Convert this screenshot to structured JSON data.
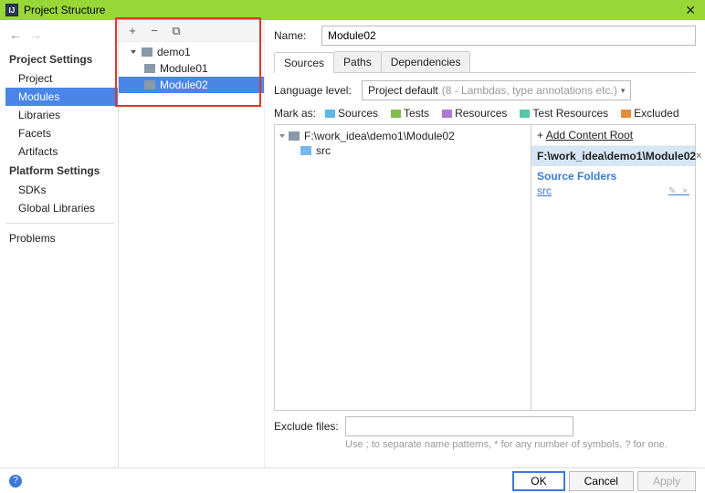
{
  "titlebar": {
    "title": "Project Structure"
  },
  "nav": {
    "back": "←",
    "forward": "→",
    "section1": "Project Settings",
    "items1": [
      "Project",
      "Modules",
      "Libraries",
      "Facets",
      "Artifacts"
    ],
    "section2": "Platform Settings",
    "items2": [
      "SDKs",
      "Global Libraries"
    ],
    "problems": "Problems"
  },
  "tree": {
    "root": "demo1",
    "children": [
      "Module01",
      "Module02"
    ]
  },
  "form": {
    "name_label": "Name:",
    "name_value": "Module02",
    "tabs": [
      "Sources",
      "Paths",
      "Dependencies"
    ],
    "lang_label": "Language level:",
    "lang_value": "Project default",
    "lang_hint": "(8 - Lambdas, type annotations etc.)",
    "markas_label": "Mark as:",
    "mark_items": [
      {
        "label": "Sources"
      },
      {
        "label": "Tests"
      },
      {
        "label": "Resources"
      },
      {
        "label": "Test Resources"
      },
      {
        "label": "Excluded"
      }
    ],
    "content_root": "F:\\work_idea\\demo1\\Module02",
    "src_folder": "src",
    "add_root_label": "Add Content Root",
    "root_path": "F:\\work_idea\\demo1\\Module02",
    "source_folders_title": "Source Folders",
    "source_folders": [
      "src"
    ],
    "exclude_label": "Exclude files:",
    "exclude_hint": "Use ; to separate name patterns, * for any number of symbols, ? for one."
  },
  "buttons": {
    "ok": "OK",
    "cancel": "Cancel",
    "apply": "Apply"
  }
}
